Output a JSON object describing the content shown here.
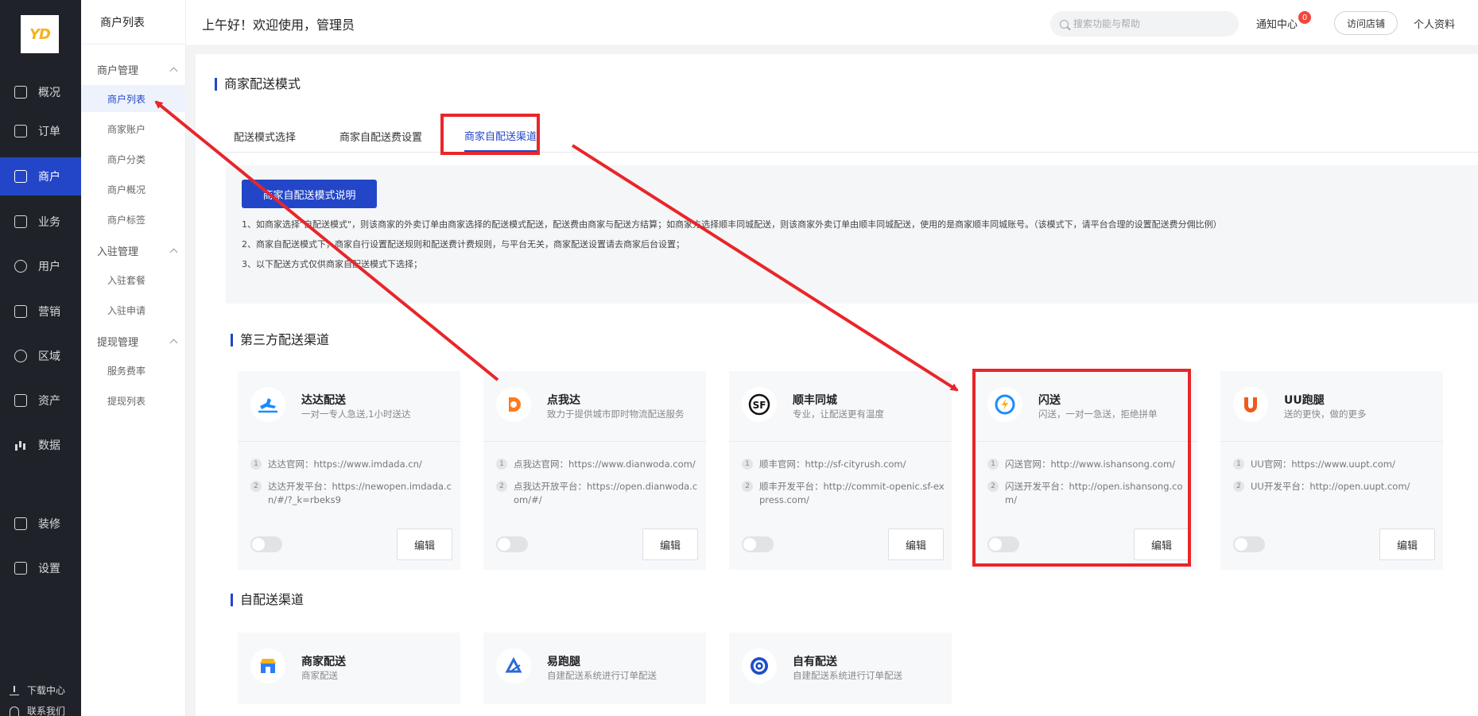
{
  "brand": {
    "logo_text": "YD"
  },
  "side_nav": {
    "items": [
      {
        "label": "概况",
        "icon": "overview-icon"
      },
      {
        "label": "订单",
        "icon": "order-icon"
      },
      {
        "label": "商户",
        "icon": "merchant-icon",
        "active": true
      },
      {
        "label": "业务",
        "icon": "business-icon"
      },
      {
        "label": "用户",
        "icon": "user-icon"
      },
      {
        "label": "营销",
        "icon": "marketing-icon"
      },
      {
        "label": "区域",
        "icon": "region-icon"
      },
      {
        "label": "资产",
        "icon": "asset-icon"
      },
      {
        "label": "数据",
        "icon": "data-icon"
      },
      {
        "label": "装修",
        "icon": "decorate-icon"
      },
      {
        "label": "设置",
        "icon": "settings-icon"
      }
    ],
    "footer": {
      "download": "下载中心",
      "contact": "联系我们"
    }
  },
  "sub_nav": {
    "title": "商户列表",
    "groups": [
      {
        "label": "商户管理",
        "items": [
          "商户列表",
          "商家账户",
          "商户分类",
          "商户概况",
          "商户标签"
        ]
      },
      {
        "label": "入驻管理",
        "items": [
          "入驻套餐",
          "入驻申请"
        ]
      },
      {
        "label": "提现管理",
        "items": [
          "服务费率",
          "提现列表"
        ]
      }
    ]
  },
  "header": {
    "greeting": "上午好！欢迎使用，管理员",
    "search_placeholder": "搜索功能与帮助",
    "notify_label": "通知中心",
    "notify_count": "0",
    "visit_store": "访问店铺",
    "profile": "个人资料"
  },
  "main": {
    "title": "商家配送模式",
    "tabs": [
      "配送模式选择",
      "商家自配送费设置",
      "商家自配送渠道"
    ],
    "active_tab": 2,
    "notice": {
      "button": "商家自配送模式说明",
      "lines": [
        "1、如商家选择\"自配送模式\"，则该商家的外卖订单由商家选择的配送模式配送，配送费由商家与配送方结算；如商家方选择顺丰同城配送，则该商家外卖订单由顺丰同城配送，使用的是商家顺丰同城账号。（该模式下，请平台合理的设置配送费分佣比例）",
        "2、商家自配送模式下，商家自行设置配送规则和配送费计费规则，与平台无关，商家配送设置请去商家后台设置；",
        "3、以下配送方式仅供商家自配送模式下选择；"
      ]
    },
    "third_party_title": "第三方配送渠道",
    "third_party": [
      {
        "name": "达达配送",
        "desc": "一对一专人急送,1小时送达",
        "logo": "dada-logo-icon",
        "color": "#1a8cff",
        "rows": [
          "达达官网：https://www.imdada.cn/",
          "达达开发平台：https://newopen.imdada.cn/#/?_k=rbeks9"
        ],
        "edit": "编辑"
      },
      {
        "name": "点我达",
        "desc": "致力于提供城市即时物流配送服务",
        "logo": "dianwoda-logo-icon",
        "color": "#ff7a1a",
        "rows": [
          "点我达官网：https://www.dianwoda.com/",
          "点我达开放平台：https://open.dianwoda.com/#/"
        ],
        "edit": "编辑"
      },
      {
        "name": "顺丰同城",
        "desc": "专业，让配送更有温度",
        "logo": "sf-logo-icon",
        "color": "#111111",
        "rows": [
          "顺丰官网：http://sf-cityrush.com/",
          "顺丰开发平台：http://commit-openic.sf-express.com/"
        ],
        "edit": "编辑"
      },
      {
        "name": "闪送",
        "desc": "闪送，一对一急送，拒绝拼单",
        "logo": "shansong-logo-icon",
        "color": "#1a8cff",
        "rows": [
          "闪送官网：http://www.ishansong.com/",
          "闪送开发平台：http://open.ishansong.com/"
        ],
        "edit": "编辑"
      },
      {
        "name": "UU跑腿",
        "desc": "送的更快，做的更多",
        "logo": "uu-logo-icon",
        "color": "#f05a1a",
        "rows": [
          "UU官网：https://www.uupt.com/",
          "UU开发平台：http://open.uupt.com/"
        ],
        "edit": "编辑"
      }
    ],
    "self_title": "自配送渠道",
    "self_channels": [
      {
        "name": "商家配送",
        "desc": "商家配送",
        "logo": "shop-logo-icon",
        "color": "#2f7cf6"
      },
      {
        "name": "易跑腿",
        "desc": "自建配送系统进行订单配送",
        "logo": "yipaotui-logo-icon",
        "color": "#2a6ad6"
      },
      {
        "name": "自有配送",
        "desc": "自建配送系统进行订单配送",
        "logo": "own-delivery-logo-icon",
        "color": "#1f4fc8"
      }
    ]
  },
  "colors": {
    "accent": "#2346c9",
    "highlight": "#e8262a",
    "sidebar": "#1f2329"
  }
}
